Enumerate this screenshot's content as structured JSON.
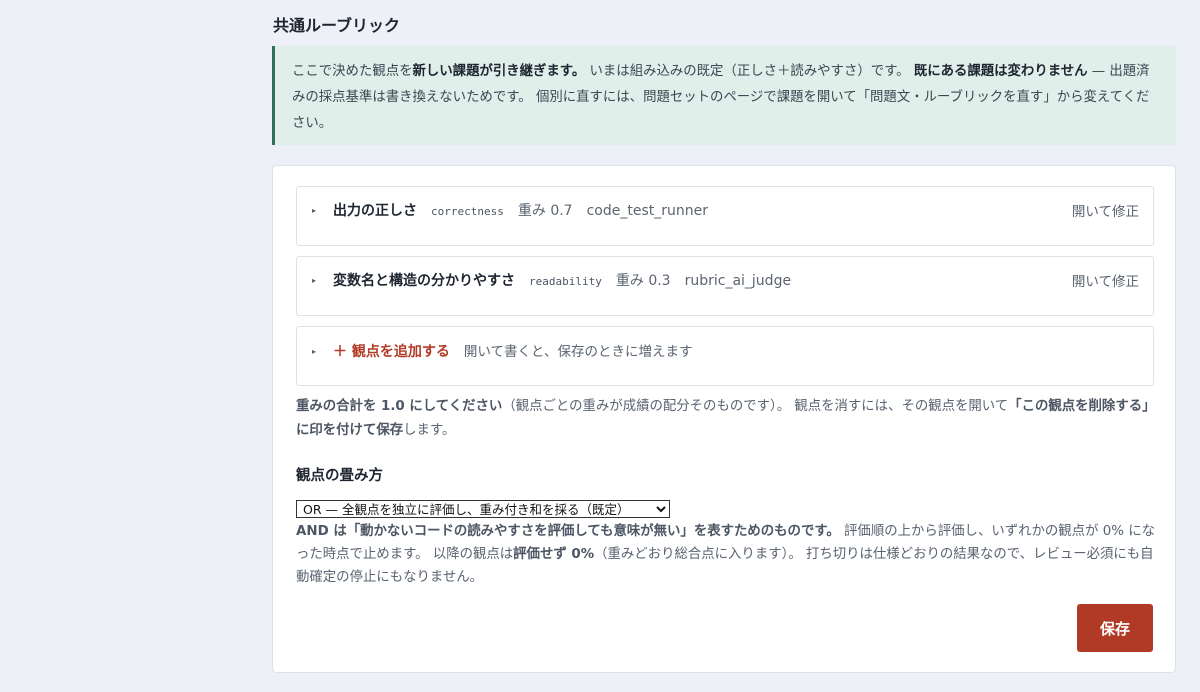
{
  "page": {
    "title": "共通ルーブリック"
  },
  "notice": {
    "p1": "ここで決めた観点を",
    "b1": "新しい課題が引き継ぎます。",
    "p2": " いまは組み込みの既定（正しさ＋読みやすさ）です。 ",
    "b2": "既にある課題は変わりません",
    "p3": " — 出題済みの採点基準は書き換えないためです。 個別に直すには、問題セットのページで課題を開いて「問題文・ルーブリックを直す」から変えてください。"
  },
  "criteria": [
    {
      "name": "出力の正しさ",
      "key": "correctness",
      "weight": "重み 0.7",
      "grader": "code_test_runner",
      "open": "開いて修正"
    },
    {
      "name": "変数名と構造の分かりやすさ",
      "key": "readability",
      "weight": "重み 0.3",
      "grader": "rubric_ai_judge",
      "open": "開いて修正"
    }
  ],
  "add": {
    "label": "＋ 観点を追加する",
    "hint": "開いて書くと、保存のときに増えます"
  },
  "weights_help": {
    "b1": "重みの合計を 1.0 にしてください",
    "p1": "（観点ごとの重みが成績の配分そのものです）。 観点を消すには、その観点を開いて",
    "b2": "「この観点を削除する」に印を付けて保存",
    "p2": "します。"
  },
  "fold": {
    "title": "観点の畳み方",
    "selected": "OR — 全観点を独立に評価し、重み付き和を採る（既定）",
    "help": {
      "b1": "AND は「動かないコードの読みやすさを評価しても意味が無い」を表すためのものです。",
      "p1": " 評価順の上から評価し、いずれかの観点が 0% になった時点で止めます。 以降の観点は",
      "b2": "評価せず 0%",
      "p2": "（重みどおり総合点に入ります）。 打ち切りは仕様どおりの結果なので、レビュー必須にも自動確定の停止にもなりません。"
    }
  },
  "actions": {
    "save": "保存"
  }
}
